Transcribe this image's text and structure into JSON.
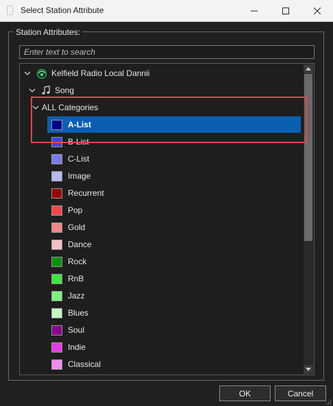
{
  "window": {
    "title": "Select Station Attribute"
  },
  "group": {
    "label": "Station Attributes:"
  },
  "search": {
    "placeholder": "Enter text to search"
  },
  "tree": {
    "station": {
      "label": "Kelfield Radio Local Dannii",
      "icon": "station-icon"
    },
    "type": {
      "label": "Song",
      "icon": "music-note-icon"
    },
    "parent": {
      "label": "ALL Categories"
    },
    "categories": [
      {
        "label": "A-List",
        "color": "#00008b",
        "selected": true
      },
      {
        "label": "B-List",
        "color": "#4b3fcf"
      },
      {
        "label": "C-List",
        "color": "#7b7be8"
      },
      {
        "label": "Image",
        "color": "#b9b9f2"
      },
      {
        "label": "Recurrent",
        "color": "#9b0000"
      },
      {
        "label": "Pop",
        "color": "#f04848"
      },
      {
        "label": "Gold",
        "color": "#f28787"
      },
      {
        "label": "Dance",
        "color": "#f6c0c0"
      },
      {
        "label": "Rock",
        "color": "#009000"
      },
      {
        "label": "RnB",
        "color": "#3fe63f"
      },
      {
        "label": "Jazz",
        "color": "#80f080"
      },
      {
        "label": "Blues",
        "color": "#c4fac4"
      },
      {
        "label": "Soul",
        "color": "#8b008b"
      },
      {
        "label": "Indie",
        "color": "#e23ce2"
      },
      {
        "label": "Classical",
        "color": "#f08cf0"
      }
    ]
  },
  "buttons": {
    "ok": "OK",
    "cancel": "Cancel"
  },
  "colors": {
    "selection": "#0a5fb0",
    "highlight_box": "#e0484f"
  }
}
